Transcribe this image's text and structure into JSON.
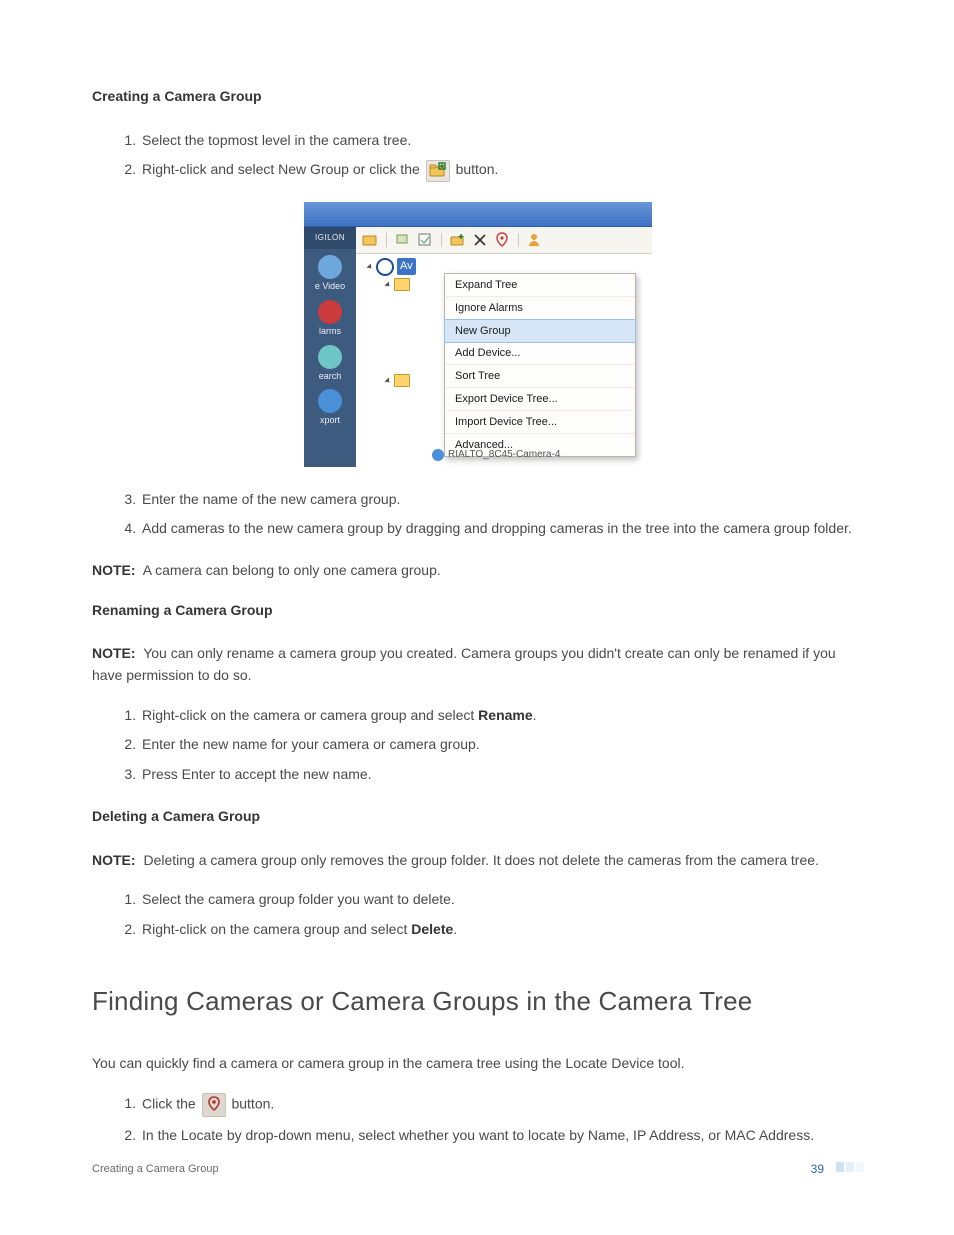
{
  "headings": {
    "creating": "Creating a Camera Group",
    "renaming": "Renaming a Camera Group",
    "deleting": "Deleting a Camera Group",
    "finding": "Finding Cameras or Camera Groups in the Camera Tree"
  },
  "creating": {
    "step1": "Select the topmost level in the camera tree.",
    "step2_a": "Right-click and select New Group or click the ",
    "step2_b": " button.",
    "step3": "Enter the name of the new camera group.",
    "step4": "Add cameras to the new camera group by dragging and dropping cameras in the tree into the camera group folder.",
    "note_label": "NOTE:",
    "note": "A camera can belong to only one camera group."
  },
  "renaming": {
    "note_label": "NOTE:",
    "note": "You can only rename a camera group you created. Camera groups you didn't create can only be renamed if you have permission to do so.",
    "step1_a": "Right-click on the camera or camera group and select ",
    "step1_bold": "Rename",
    "step1_b": ".",
    "step2": "Enter the new name for your camera or camera group.",
    "step3": "Press Enter to accept the new name."
  },
  "deleting": {
    "note_label": "NOTE:",
    "note": "Deleting a camera group only removes the group folder. It does not delete the cameras from the camera tree.",
    "step1": "Select the camera group folder you want to delete.",
    "step2_a": "Right-click on the camera group and select ",
    "step2_bold": "Delete",
    "step2_b": "."
  },
  "finding": {
    "intro": "You can quickly find a camera or camera group in the camera tree using the Locate Device tool.",
    "step1_a": "Click the ",
    "step1_b": " button.",
    "step2": "In the Locate by drop-down menu, select whether you want to locate by Name, IP Address, or MAC Address."
  },
  "screenshot": {
    "brand": "IGILON",
    "side_items": [
      "e Video",
      "larms",
      "earch",
      "xport"
    ],
    "tree_label": "Av",
    "camera_row": "RIALTO_8C45-Camera-4",
    "menu": [
      "Expand Tree",
      "Ignore Alarms",
      "New Group",
      "Add Device...",
      "Sort Tree",
      "Export Device Tree...",
      "Import Device Tree...",
      "Advanced..."
    ],
    "menu_highlight_index": 2
  },
  "footer": {
    "left": "Creating a Camera Group",
    "page": "39"
  }
}
